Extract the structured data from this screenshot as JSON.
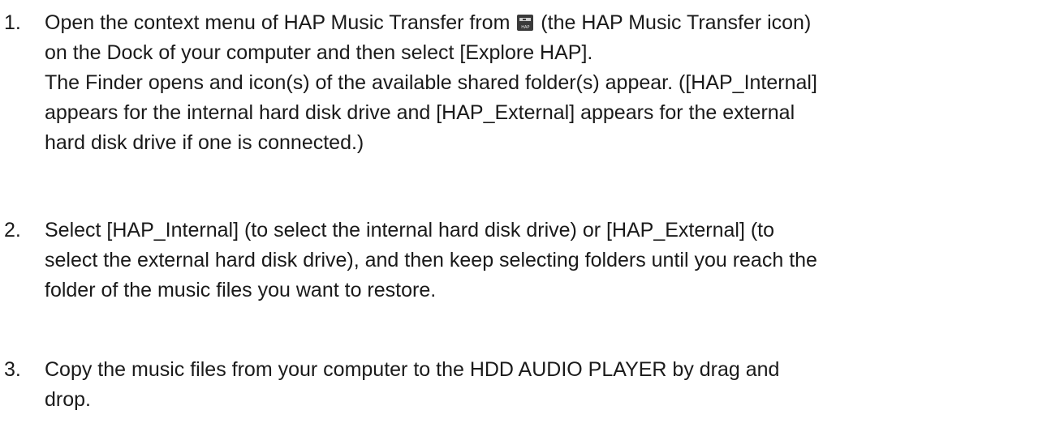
{
  "steps": [
    {
      "number": "1.",
      "line1_before_icon": "Open the context menu of HAP Music Transfer from ",
      "line1_after_icon": " (the HAP Music Transfer icon)",
      "icon": {
        "name": "hap-music-transfer-icon",
        "label": "HAP"
      },
      "lines": [
        "on the Dock of your computer and then select [Explore HAP].",
        "The Finder opens and icon(s) of the available shared folder(s) appear. ([HAP_Internal]",
        "appears for the internal hard disk drive and [HAP_External] appears for the external",
        "hard disk drive if one is connected.)"
      ]
    },
    {
      "number": "2.",
      "lines": [
        "Select [HAP_Internal] (to select the internal hard disk drive) or [HAP_External] (to",
        "select the external hard disk drive), and then keep selecting folders until you reach the",
        "folder of the music files you want to restore."
      ]
    },
    {
      "number": "3.",
      "lines": [
        "Copy the music files from your computer to the HDD AUDIO PLAYER by drag and",
        "drop."
      ]
    }
  ]
}
